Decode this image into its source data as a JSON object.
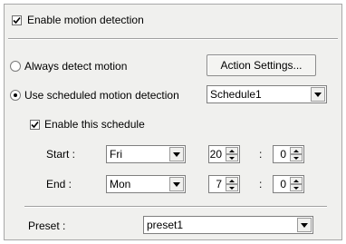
{
  "motion": {
    "enable_label": "Enable motion detection",
    "enable_checked": true,
    "always_label": "Always detect motion",
    "action_button_label": "Action Settings...",
    "scheduled_label": "Use scheduled motion detection",
    "schedule_select_value": "Schedule1",
    "enable_schedule_label": "Enable this schedule",
    "start_label": "Start :",
    "start_day": "Fri",
    "start_hour": "20",
    "start_minute": "0",
    "end_label": "End :",
    "end_day": "Mon",
    "end_hour": "7",
    "end_minute": "0",
    "colon": ":",
    "preset_label": "Preset :",
    "preset_value": "preset1"
  },
  "icons": {
    "check": "check-icon",
    "dropdown": "chevron-down-icon",
    "spin_up": "spin-up-icon",
    "spin_down": "spin-down-icon"
  }
}
